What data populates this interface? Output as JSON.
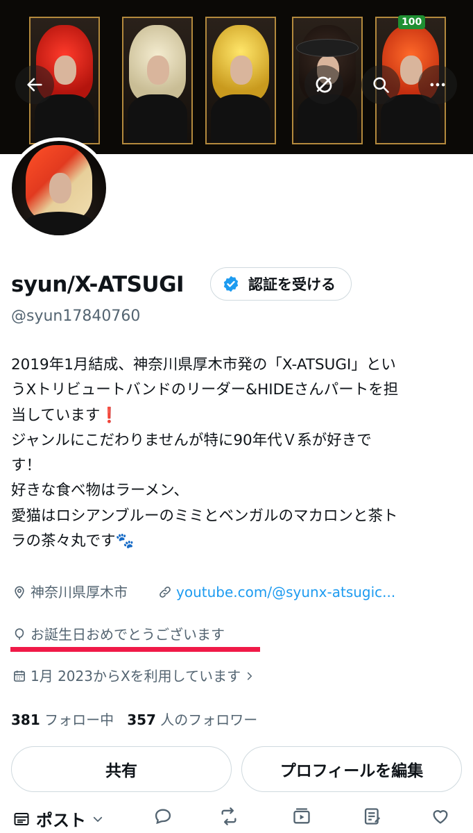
{
  "header": {
    "banner_badge": "100",
    "back_icon": "arrow-left-icon",
    "sync_off_icon": "sync-off-icon",
    "search_icon": "search-icon",
    "more_icon": "more-icon"
  },
  "profile": {
    "name": "syun/X-ATSUGI",
    "verify_label": "認証を受ける",
    "handle": "@syun17840760",
    "bio_lines": [
      "2019年1月結成、神奈川県厚木市発の「X-ATSUGI」とい",
      "うXトリビュートバンドのリーダー&HIDEさんパートを担",
      "当しています",
      "ジャンルにこだわりませんが特に90年代Ｖ系が好きで",
      "す！",
      "好きな食べ物はラーメン、",
      "愛猫はロシアンブルーのミミとベンガルのマカロンと茶ト",
      "ラの茶々丸です"
    ],
    "bio_exclamation_emoji": "❗",
    "bio_paw_emoji": "🐾",
    "location": "神奈川県厚木市",
    "website": "youtube.com/@syunx-atsugic...",
    "birthday": "お誕生日おめでとうございます",
    "joined": "1月 2023からXを利用しています",
    "following_count": "381",
    "following_label": "フォロー中",
    "followers_count": "357",
    "followers_label": "人のフォロワー"
  },
  "actions": {
    "share_label": "共有",
    "edit_label": "プロフィールを編集"
  },
  "tabs": {
    "posts_label": "ポスト"
  },
  "colors": {
    "accent": "#1d9bf0",
    "highlight_underline": "#f01a48",
    "banner_frame": "#b48a3d"
  }
}
